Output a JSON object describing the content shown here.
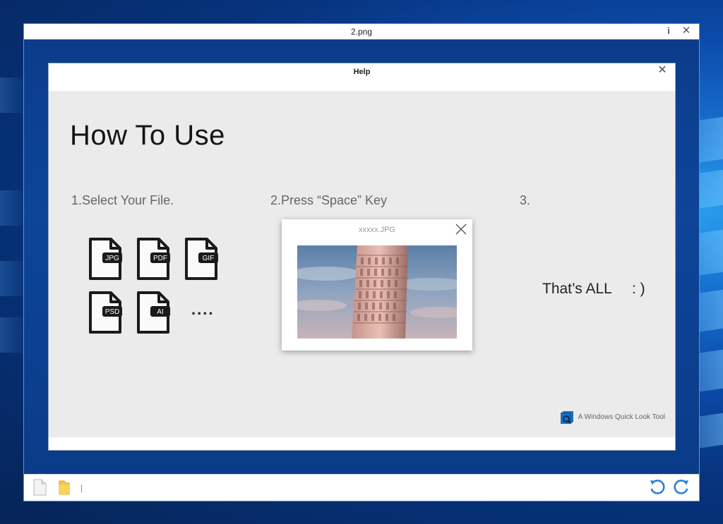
{
  "viewer": {
    "title": "2.png",
    "info_glyph": "i",
    "close_glyph": "✕",
    "path_text": "|"
  },
  "help_dialog": {
    "title": "Help",
    "close_glyph": "✕",
    "heading": "How To Use",
    "steps": [
      {
        "label": "1.Select Your File."
      },
      {
        "label": "2.Press “Space” Key"
      },
      {
        "label": "3."
      }
    ],
    "file_types": [
      "JPG",
      "PDF",
      "GIF",
      "PSD",
      "AI"
    ],
    "more_indicator": "....",
    "preview": {
      "filename": "xxxxx.JPG"
    },
    "closing_text": "That’s ALL",
    "smiley": ": )",
    "brand_text": "A Windows Quick Look Tool"
  },
  "colors": {
    "desktop_blue": "#0b3f8f",
    "dialog_bg": "#ebebeb",
    "icon_dark": "#1a1a1a"
  }
}
